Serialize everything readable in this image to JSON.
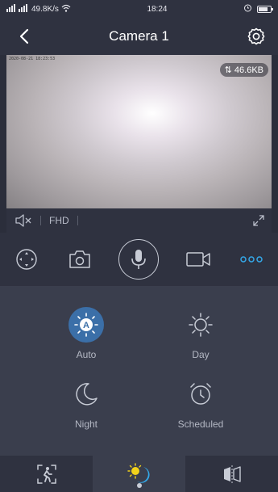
{
  "status_bar": {
    "network": "3Gil 3Gil",
    "speed": "49.8K/s",
    "time": "18:24"
  },
  "header": {
    "title": "Camera 1"
  },
  "video": {
    "osd_text": "2020-08-21 18:23:53",
    "bitrate": "46.6KB",
    "quality": "FHD"
  },
  "modes": {
    "auto": "Auto",
    "day": "Day",
    "night": "Night",
    "scheduled": "Scheduled"
  },
  "colors": {
    "accent": "#3b6fa8",
    "more_dots": "#34a8e8",
    "background": "#2b2e3b",
    "panel": "#3a3e4d"
  }
}
